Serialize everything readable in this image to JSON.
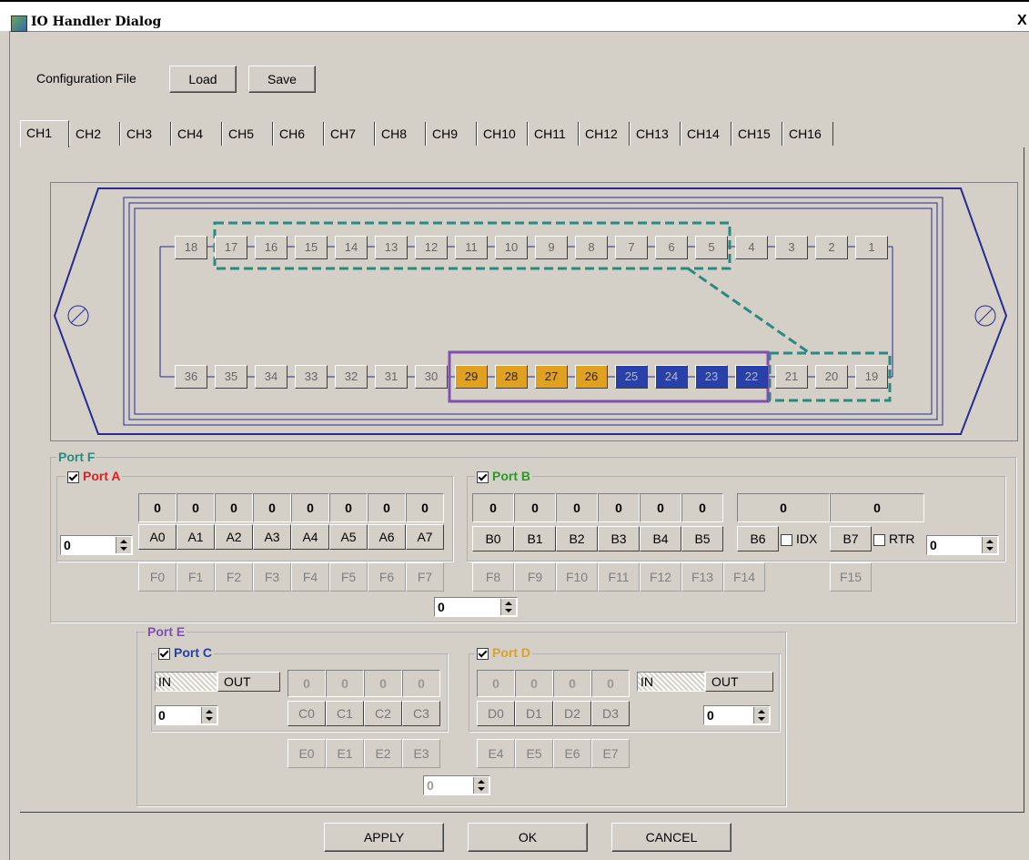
{
  "window": {
    "title": "IO Handler Dialog",
    "close_glyph": "X"
  },
  "config": {
    "label": "Configuration File",
    "load": "Load",
    "save": "Save"
  },
  "tabs": [
    "CH1",
    "CH2",
    "CH3",
    "CH4",
    "CH5",
    "CH6",
    "CH7",
    "CH8",
    "CH9",
    "CH10",
    "CH11",
    "CH12",
    "CH13",
    "CH14",
    "CH15",
    "CH16"
  ],
  "active_tab": "CH1",
  "connector": {
    "top_pins": [
      "18",
      "17",
      "16",
      "15",
      "14",
      "13",
      "12",
      "11",
      "10",
      "9",
      "8",
      "7",
      "6",
      "5",
      "4",
      "3",
      "2",
      "1"
    ],
    "bottom_pins": [
      "36",
      "35",
      "34",
      "33",
      "32",
      "31",
      "30",
      "29",
      "28",
      "27",
      "26",
      "25",
      "24",
      "23",
      "22",
      "21",
      "20",
      "19"
    ],
    "gold_pins": [
      "29",
      "28",
      "27",
      "26"
    ],
    "blue_pins": [
      "25",
      "24",
      "23",
      "22"
    ],
    "colors": {
      "gold": "#e0a020",
      "blue": "#2840a8",
      "teal_dashed": "#2a8a80",
      "purple_box": "#8050b0",
      "outline": "#2a2a90"
    }
  },
  "port_f": {
    "label": "Port F",
    "label_color": "#2a8a80",
    "f_labels": [
      "F0",
      "F1",
      "F2",
      "F3",
      "F4",
      "F5",
      "F6",
      "F7",
      "F8",
      "F9",
      "F10",
      "F11",
      "F12",
      "F13",
      "F14",
      "F15"
    ],
    "spin_value": "0"
  },
  "port_a": {
    "label": "Port A",
    "label_color": "#e02020",
    "checked": true,
    "values": [
      "0",
      "0",
      "0",
      "0",
      "0",
      "0",
      "0",
      "0"
    ],
    "buttons": [
      "A0",
      "A1",
      "A2",
      "A3",
      "A4",
      "A5",
      "A6",
      "A7"
    ],
    "spin_value": "0"
  },
  "port_b": {
    "label": "Port B",
    "label_color": "#20a020",
    "checked": true,
    "values": [
      "0",
      "0",
      "0",
      "0",
      "0",
      "0",
      "0",
      "0"
    ],
    "buttons": [
      "B0",
      "B1",
      "B2",
      "B3",
      "B4",
      "B5",
      "B6",
      "B7"
    ],
    "idx_label": "IDX",
    "rtr_label": "RTR",
    "spin_value": "0"
  },
  "port_e": {
    "label": "Port E",
    "label_color": "#8050b0",
    "e_labels": [
      "E0",
      "E1",
      "E2",
      "E3",
      "E4",
      "E5",
      "E6",
      "E7"
    ],
    "spin_value": "0"
  },
  "port_c": {
    "label": "Port C",
    "label_color": "#2040b0",
    "checked": true,
    "in_label": "IN",
    "out_label": "OUT",
    "values": [
      "0",
      "0",
      "0",
      "0"
    ],
    "buttons": [
      "C0",
      "C1",
      "C2",
      "C3"
    ],
    "spin_value": "0"
  },
  "port_d": {
    "label": "Port D",
    "label_color": "#e0a020",
    "checked": true,
    "in_label": "IN",
    "out_label": "OUT",
    "values": [
      "0",
      "0",
      "0",
      "0"
    ],
    "buttons": [
      "D0",
      "D1",
      "D2",
      "D3"
    ],
    "spin_value": "0"
  },
  "footer": {
    "apply": "APPLY",
    "ok": "OK",
    "cancel": "CANCEL"
  }
}
